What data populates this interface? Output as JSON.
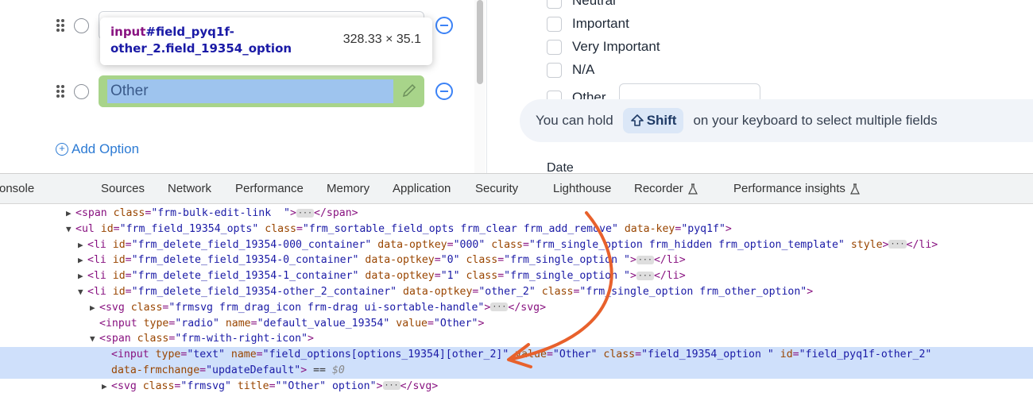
{
  "form_builder": {
    "options": [
      {
        "value": ""
      },
      {
        "value": "Other"
      }
    ],
    "add_option_label": "Add Option"
  },
  "tooltip": {
    "selector_tag": "input",
    "selector_rest": "#field_pyq1f-other_2.field_19354_option",
    "dimensions": "328.33 × 35.1"
  },
  "preview": {
    "choices": [
      "Neutral",
      "Important",
      "Very Important",
      "N/A",
      "Other"
    ],
    "hint_before": "You can hold",
    "hint_key": "Shift",
    "hint_after": "on your keyboard to select multiple fields",
    "date_label": "Date"
  },
  "devtools": {
    "tabs": [
      "onsole",
      "Sources",
      "Network",
      "Performance",
      "Memory",
      "Application",
      "Security",
      "Lighthouse",
      "Recorder",
      "Performance insights"
    ],
    "lines": [
      {
        "indent": 85,
        "tri": "▶",
        "html": "<span class=\"t\">&lt;span</span> <span class=\"a\">class</span><span class=\"p\">=</span><span class=\"v\">\"frm-bulk-edit-link  \"</span><span class=\"t\">&gt;</span><span class=\"ell\">···</span><span class=\"t\">&lt;/span&gt;</span>"
      },
      {
        "indent": 85,
        "tri": "▼",
        "html": "<span class=\"t\">&lt;ul</span> <span class=\"a\">id</span><span class=\"p\">=</span><span class=\"v\">\"frm_field_19354_opts\"</span> <span class=\"a\">class</span><span class=\"p\">=</span><span class=\"v\">\"frm_sortable_field_opts frm_clear frm_add_remove\"</span> <span class=\"a\">data-key</span><span class=\"p\">=</span><span class=\"v\">\"pyq1f\"</span><span class=\"t\">&gt;</span>"
      },
      {
        "indent": 100,
        "tri": "▶",
        "html": "<span class=\"t\">&lt;li</span> <span class=\"a\">id</span><span class=\"p\">=</span><span class=\"v\">\"frm_delete_field_19354-000_container\"</span> <span class=\"a\">data-optkey</span><span class=\"p\">=</span><span class=\"v\">\"000\"</span> <span class=\"a\">class</span><span class=\"p\">=</span><span class=\"v\">\"frm_single_option frm_hidden frm_option_template\"</span> <span class=\"a\">style</span><span class=\"t\">&gt;</span><span class=\"ell\">···</span><span class=\"t\">&lt;/li&gt;</span>"
      },
      {
        "indent": 100,
        "tri": "▶",
        "html": "<span class=\"t\">&lt;li</span> <span class=\"a\">id</span><span class=\"p\">=</span><span class=\"v\">\"frm_delete_field_19354-0_container\"</span> <span class=\"a\">data-optkey</span><span class=\"p\">=</span><span class=\"v\">\"0\"</span> <span class=\"a\">class</span><span class=\"p\">=</span><span class=\"v\">\"frm_single_option \"</span><span class=\"t\">&gt;</span><span class=\"ell\">···</span><span class=\"t\">&lt;/li&gt;</span>"
      },
      {
        "indent": 100,
        "tri": "▶",
        "html": "<span class=\"t\">&lt;li</span> <span class=\"a\">id</span><span class=\"p\">=</span><span class=\"v\">\"frm_delete_field_19354-1_container\"</span> <span class=\"a\">data-optkey</span><span class=\"p\">=</span><span class=\"v\">\"1\"</span> <span class=\"a\">class</span><span class=\"p\">=</span><span class=\"v\">\"frm_single_option \"</span><span class=\"t\">&gt;</span><span class=\"ell\">···</span><span class=\"t\">&lt;/li&gt;</span>"
      },
      {
        "indent": 100,
        "tri": "▼",
        "html": "<span class=\"t\">&lt;li</span> <span class=\"a\">id</span><span class=\"p\">=</span><span class=\"v\">\"frm_delete_field_19354-other_2_container\"</span> <span class=\"a\">data-optkey</span><span class=\"p\">=</span><span class=\"v\">\"other_2\"</span> <span class=\"a\">class</span><span class=\"p\">=</span><span class=\"v\">\"frm_single_option frm_other_option\"</span><span class=\"t\">&gt;</span>"
      },
      {
        "indent": 115,
        "tri": "▶",
        "html": "<span class=\"t\">&lt;svg</span> <span class=\"a\">class</span><span class=\"p\">=</span><span class=\"v\">\"frmsvg frm_drag_icon frm-drag ui-sortable-handle\"</span><span class=\"t\">&gt;</span><span class=\"ell\">···</span><span class=\"t\">&lt;/svg&gt;</span>"
      },
      {
        "indent": 115,
        "tri": " ",
        "html": "<span class=\"t\">&lt;input</span> <span class=\"a\">type</span><span class=\"p\">=</span><span class=\"v\">\"radio\"</span> <span class=\"a\">name</span><span class=\"p\">=</span><span class=\"v\">\"default_value_19354\"</span> <span class=\"a\">value</span><span class=\"p\">=</span><span class=\"v\">\"Other\"</span><span class=\"t\">&gt;</span>"
      },
      {
        "indent": 115,
        "tri": "▼",
        "html": "<span class=\"t\">&lt;span</span> <span class=\"a\">class</span><span class=\"p\">=</span><span class=\"v\">\"frm-with-right-icon\"</span><span class=\"t\">&gt;</span>"
      },
      {
        "indent": 130,
        "tri": " ",
        "html": "<span class=\"t\">&lt;input</span> <span class=\"a\">type</span><span class=\"p\">=</span><span class=\"v\">\"text\"</span> <span class=\"a\">name</span><span class=\"p\">=</span><span class=\"v\">\"field_options[options_19354][other_2]\"</span> <span class=\"a\">value</span><span class=\"p\">=</span><span class=\"v\">\"Other\"</span> <span class=\"a\">class</span><span class=\"p\">=</span><span class=\"v\">\"field_19354_option \"</span> <span class=\"a\">id</span><span class=\"p\">=</span><span class=\"v\">\"field_pyq1f-other_2\"</span>",
        "selected": true
      },
      {
        "indent": 130,
        "tri": " ",
        "html": "<span class=\"a\">data-frmchange</span><span class=\"p\">=</span><span class=\"v\">\"updateDefault\"</span><span class=\"t\">&gt;</span> <span style=\"color:#333\">==</span> <span class=\"dim\">$0</span>",
        "selected": true
      },
      {
        "indent": 130,
        "tri": "▶",
        "html": "<span class=\"t\">&lt;svg</span> <span class=\"a\">class</span><span class=\"p\">=</span><span class=\"v\">\"frmsvg\"</span> <span class=\"a\">title</span><span class=\"p\">=</span><span class=\"v\">\"\"Other\" option\"</span><span class=\"t\">&gt;</span><span class=\"ell\">···</span><span class=\"t\">&lt;/svg&gt;</span>"
      }
    ]
  }
}
